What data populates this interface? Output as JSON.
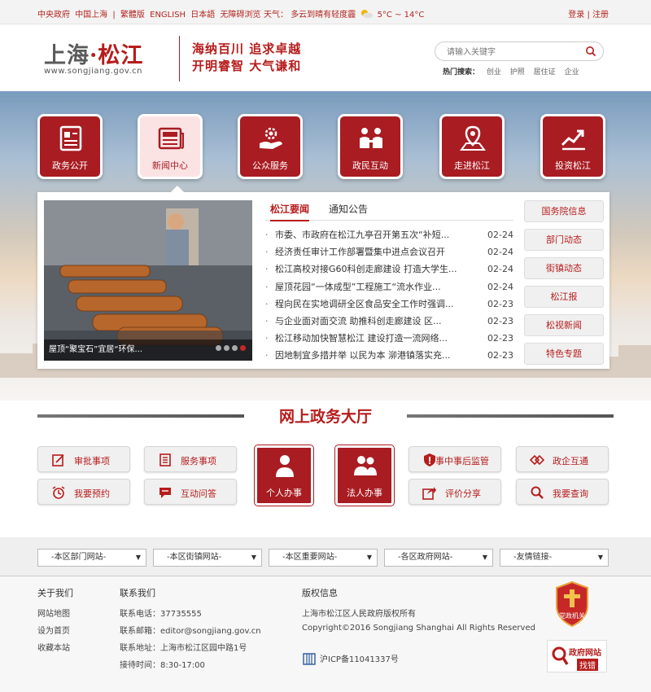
{
  "topbar": {
    "links": [
      "中央政府",
      "中国上海",
      "繁體版",
      "ENGLISH",
      "日本語",
      "无障碍浏览"
    ],
    "weather_label": "天气：",
    "weather_text": "多云到晴有轻度霾",
    "temperature": "5°C ~ 14°C",
    "login": "登录",
    "separator": "|",
    "register": "注册"
  },
  "header": {
    "logo_part1": "上海",
    "logo_dot": "·",
    "logo_part2": "松江",
    "logo_url": "www.songjiang.gov.cn",
    "slogan_line1": "海纳百川  追求卓越",
    "slogan_line2": "开明睿智  大气谦和",
    "search_placeholder": "请输入关键字",
    "hot_label": "热门搜索：",
    "hot_terms": [
      "创业",
      "护照",
      "居住证",
      "企业"
    ]
  },
  "nav": [
    {
      "label": "政务公开",
      "icon": "document-icon",
      "active": false
    },
    {
      "label": "新闻中心",
      "icon": "newspaper-icon",
      "active": true
    },
    {
      "label": "公众服务",
      "icon": "hand-gear-icon",
      "active": false
    },
    {
      "label": "政民互动",
      "icon": "people-talk-icon",
      "active": false
    },
    {
      "label": "走进松江",
      "icon": "map-pin-icon",
      "active": false
    },
    {
      "label": "投资松江",
      "icon": "chart-up-icon",
      "active": false
    }
  ],
  "news": {
    "photo_caption": "屋顶“聚宝石”宜居“环保...",
    "carousel_active_index": 4,
    "tabs": [
      "松江要闻",
      "通知公告"
    ],
    "active_tab": 0,
    "bullet": "·",
    "items": [
      {
        "title": "市委、市政府在松江九亭召开第五次“补短...",
        "date": "02-24"
      },
      {
        "title": "经济责任审计工作部署暨集中进点会议召开",
        "date": "02-24"
      },
      {
        "title": "松江高校对接G60科创走廊建设 打造大学生...",
        "date": "02-24"
      },
      {
        "title": "屋顶花园“一体成型”工程施工“流水作业...",
        "date": "02-24"
      },
      {
        "title": "程向民在实地调研全区食品安全工作时强调...",
        "date": "02-23"
      },
      {
        "title": "与企业面对面交流 助推科创走廊建设   区...",
        "date": "02-23"
      },
      {
        "title": "松江移动加快智慧松江 建设打造一流网络...",
        "date": "02-23"
      },
      {
        "title": "因地制宜多措并举 以民为本 泖港镇落实充...",
        "date": "02-23"
      }
    ],
    "side_links": [
      "国务院信息",
      "部门动态",
      "街镇动态",
      "松江报",
      "松视新闻",
      "特色专题"
    ]
  },
  "hall": {
    "title": "网上政务大厅",
    "left_services": [
      {
        "label": "审批事项",
        "icon": "edit-icon"
      },
      {
        "label": "服务事项",
        "icon": "list-icon"
      },
      {
        "label": "我要预约",
        "icon": "alarm-clock-icon"
      },
      {
        "label": "互动问答",
        "icon": "chat-icon"
      }
    ],
    "center_services": [
      {
        "label": "个人办事",
        "icon": "person-icon"
      },
      {
        "label": "法人办事",
        "icon": "group-icon"
      }
    ],
    "right_services": [
      {
        "label": "事中事后监管",
        "icon": "shield-icon"
      },
      {
        "label": "政企互通",
        "icon": "diamond-link-icon"
      },
      {
        "label": "评价分享",
        "icon": "share-icon"
      },
      {
        "label": "我要查询",
        "icon": "search-icon"
      }
    ]
  },
  "selects": [
    "-本区部门网站-",
    "-本区街镇网站-",
    "-本区重要网站-",
    "-各区政府网站-",
    "-友情链接-"
  ],
  "footer": {
    "about_title": "关于我们",
    "about_links": [
      "网站地图",
      "设为首页",
      "收藏本站"
    ],
    "contact_title": "联系我们",
    "contact_items": [
      "联系电话：37735555",
      "联系邮箱：editor@songjiang.gov.cn",
      "联系地址：上海市松江区园中路1号",
      "接待时间：8:30-17:00"
    ],
    "copyright_title": "版权信息",
    "copyright_lines": [
      "上海市松江区人民政府版权所有",
      "Copyright©2016 Songjiang Shanghai All Rights Reserved"
    ],
    "icp": "沪ICP备11041337号",
    "badge1_text": "党政机关",
    "badge2_line1": "政府网站",
    "badge2_line2": "找错"
  },
  "colors": {
    "brand": "#a81c22",
    "text_red": "#b71c1c"
  }
}
